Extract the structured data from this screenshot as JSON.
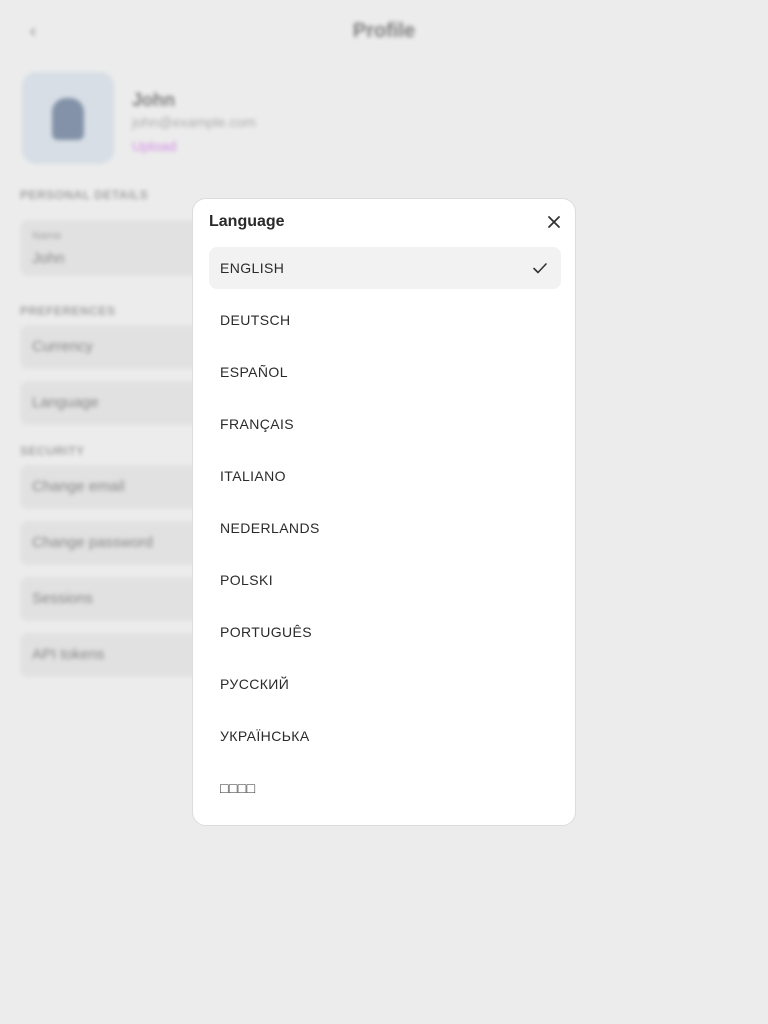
{
  "background": {
    "back_icon": "back-icon",
    "page_title": "Profile",
    "user": {
      "name": "John",
      "email": "john@example.com",
      "link": "Upload"
    },
    "sections": {
      "personal": "PERSONAL DETAILS",
      "preferences": "PREFERENCES",
      "security": "SECURITY"
    },
    "name_field": {
      "caption": "Name",
      "value": "John"
    },
    "preferences_items": [
      "Currency",
      "Language"
    ],
    "security_items": [
      "Change email",
      "Change password",
      "Sessions",
      "API tokens"
    ]
  },
  "modal": {
    "title": "Language",
    "close_icon": "close-icon",
    "selected_index": 0,
    "items": [
      {
        "label": "ENGLISH",
        "selected": true
      },
      {
        "label": "DEUTSCH",
        "selected": false
      },
      {
        "label": "ESPAÑOL",
        "selected": false
      },
      {
        "label": "FRANÇAIS",
        "selected": false
      },
      {
        "label": "ITALIANO",
        "selected": false
      },
      {
        "label": "NEDERLANDS",
        "selected": false
      },
      {
        "label": "POLSKI",
        "selected": false
      },
      {
        "label": "PORTUGUÊS",
        "selected": false
      },
      {
        "label": "РУССКИЙ",
        "selected": false
      },
      {
        "label": "УКРАЇНСЬКА",
        "selected": false
      },
      {
        "label": "□□□□",
        "selected": false
      }
    ]
  },
  "colors": {
    "backdrop": "#ececec",
    "modal_bg": "#ffffff",
    "selected_bg": "#f2f2f2",
    "text": "#2a2a2a",
    "accent_link": "#c040e0"
  }
}
